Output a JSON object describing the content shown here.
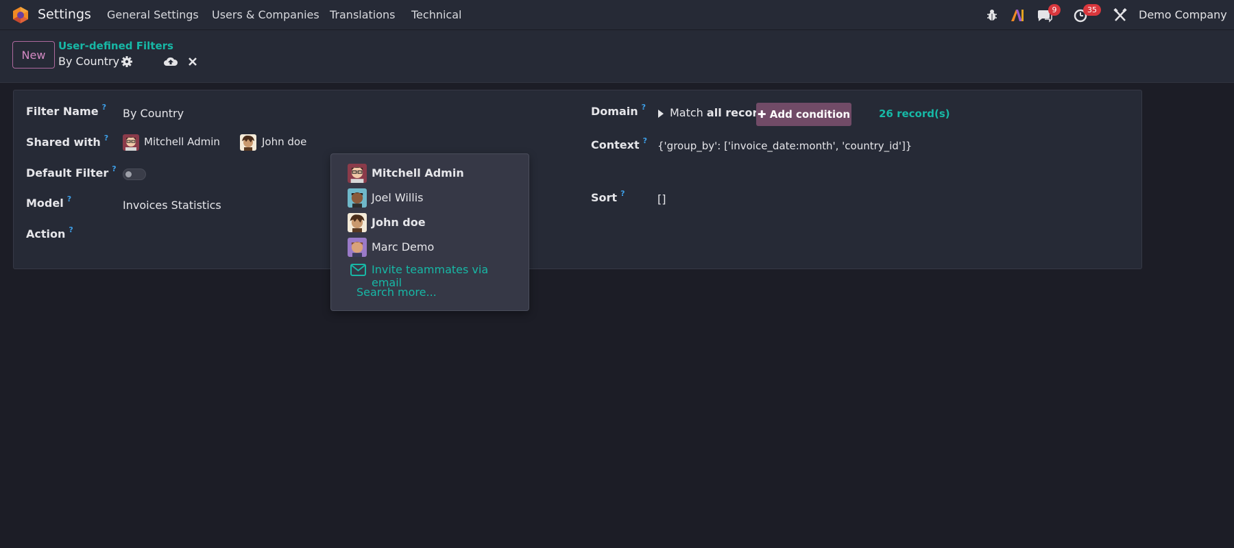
{
  "topbar": {
    "app_title": "Settings",
    "menu": [
      "General Settings",
      "Users & Companies",
      "Translations",
      "Technical"
    ],
    "messages_count": "9",
    "activities_count": "35",
    "company": "Demo Company",
    "icons": [
      "bug-icon",
      "ai-icon",
      "chat-icon",
      "clock-icon",
      "tools-icon"
    ]
  },
  "control": {
    "new_label": "New",
    "breadcrumb": "User-defined Filters",
    "record_name": "By Country"
  },
  "form": {
    "filter_name_label": "Filter Name",
    "filter_name": "By Country",
    "shared_with_label": "Shared with",
    "shared_users": [
      "Mitchell Admin",
      "John doe"
    ],
    "default_filter_label": "Default Filter",
    "default_filter": false,
    "model_label": "Model",
    "model": "Invoices Statistics",
    "action_label": "Action",
    "domain_label": "Domain",
    "match_prefix": "Match",
    "match_value": "all records",
    "add_condition": "Add condition",
    "records": "26 record(s)",
    "context_label": "Context",
    "context": "{'group_by': ['invoice_date:month', 'country_id']}",
    "sort_label": "Sort",
    "sort": "[]",
    "help": "?"
  },
  "dropdown": {
    "items": [
      {
        "name": "Mitchell Admin",
        "selected": true
      },
      {
        "name": "Joel Willis",
        "selected": false
      },
      {
        "name": "John doe",
        "selected": true
      },
      {
        "name": "Marc Demo",
        "selected": false
      }
    ],
    "invite": "Invite teammates via email",
    "search_more": "Search more..."
  },
  "colors": {
    "accent": "#17b8a6",
    "primary": "#714b67",
    "badge": "#d9373d",
    "background": "#1c1d26",
    "panel": "#262a36"
  }
}
